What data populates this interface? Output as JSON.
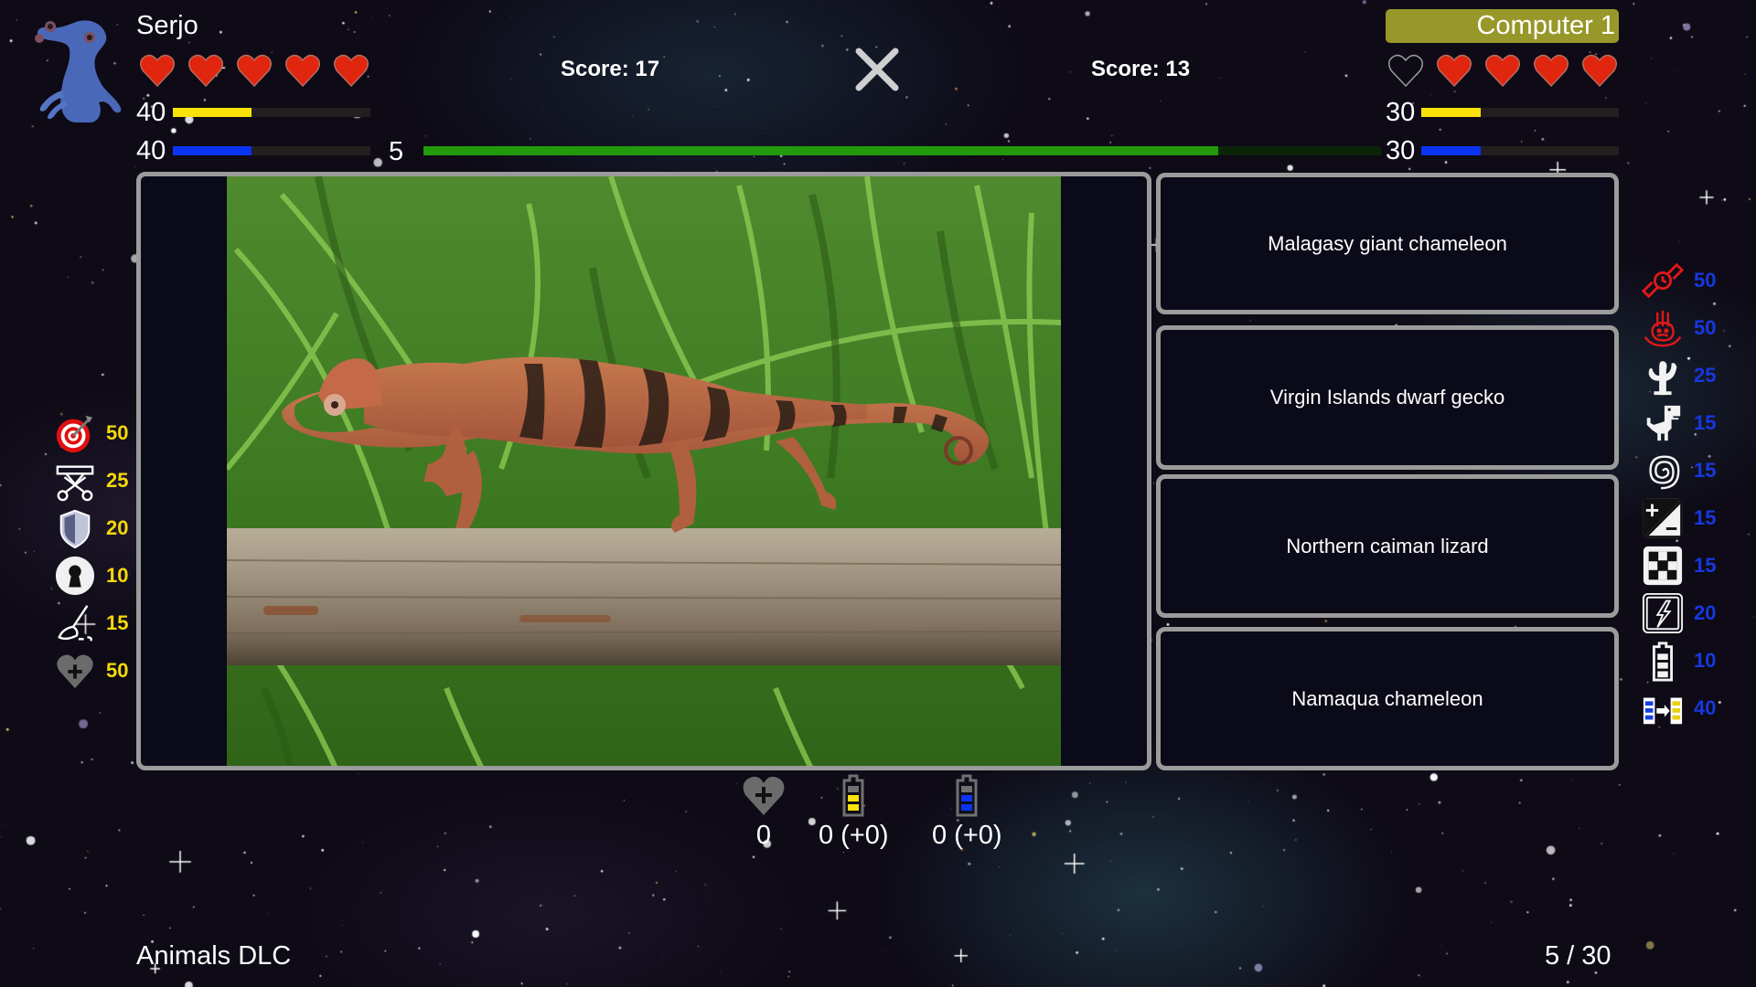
{
  "player": {
    "name": "Serjo",
    "avatar": "blue-alien-creature",
    "hearts": [
      true,
      true,
      true,
      true,
      true
    ],
    "score_label": "Score: 17",
    "yellow_energy": {
      "value": "40",
      "fraction": 0.4
    },
    "blue_energy": {
      "value": "40",
      "fraction": 0.4
    },
    "color_yellow": "#f9e20a",
    "color_blue": "#0a34f0"
  },
  "opponent": {
    "name": "Computer 1",
    "badge_color": "#98972a",
    "hearts": [
      false,
      true,
      true,
      true,
      true
    ],
    "score_label": "Score: 13",
    "yellow_energy": {
      "value": "30",
      "fraction": 0.3
    },
    "blue_energy": {
      "value": "30",
      "fraction": 0.3
    }
  },
  "timer": {
    "seconds": "5",
    "fraction": 0.83,
    "color": "#229a0c"
  },
  "close_icon": "close-x-icon",
  "question": {
    "image": "chameleon-on-log-photo",
    "answers": [
      "Malagasy giant chameleon",
      "Virgin Islands dwarf gecko",
      "Northern caiman lizard",
      "Namaqua chameleon"
    ]
  },
  "player_powerups": [
    {
      "icon": "target-icon",
      "cost": "50"
    },
    {
      "icon": "scissors-ribbon-icon",
      "cost": "25"
    },
    {
      "icon": "shield-icon",
      "cost": "20"
    },
    {
      "icon": "keyhole-icon",
      "cost": "10"
    },
    {
      "icon": "mop-icon",
      "cost": "15"
    },
    {
      "icon": "heart-plus-icon",
      "cost": "50"
    }
  ],
  "opponent_powerups": [
    {
      "icon": "wristwatch-icon",
      "cost": "50"
    },
    {
      "icon": "hand-icon",
      "cost": "50"
    },
    {
      "icon": "cactus-icon",
      "cost": "25"
    },
    {
      "icon": "dinosaur-icon",
      "cost": "15"
    },
    {
      "icon": "spiral-icon",
      "cost": "15"
    },
    {
      "icon": "plus-minus-icon",
      "cost": "15"
    },
    {
      "icon": "checker-icon",
      "cost": "15"
    },
    {
      "icon": "lightning-icon",
      "cost": "20"
    },
    {
      "icon": "battery-icon",
      "cost": "10"
    },
    {
      "icon": "battery-swap-icon",
      "cost": "40"
    }
  ],
  "resources": {
    "hearts_extra": "0",
    "yellow_battery": "0 (+0)",
    "blue_battery": "0 (+0)"
  },
  "footer": {
    "category": "Animals DLC",
    "progress": "5 / 30"
  }
}
